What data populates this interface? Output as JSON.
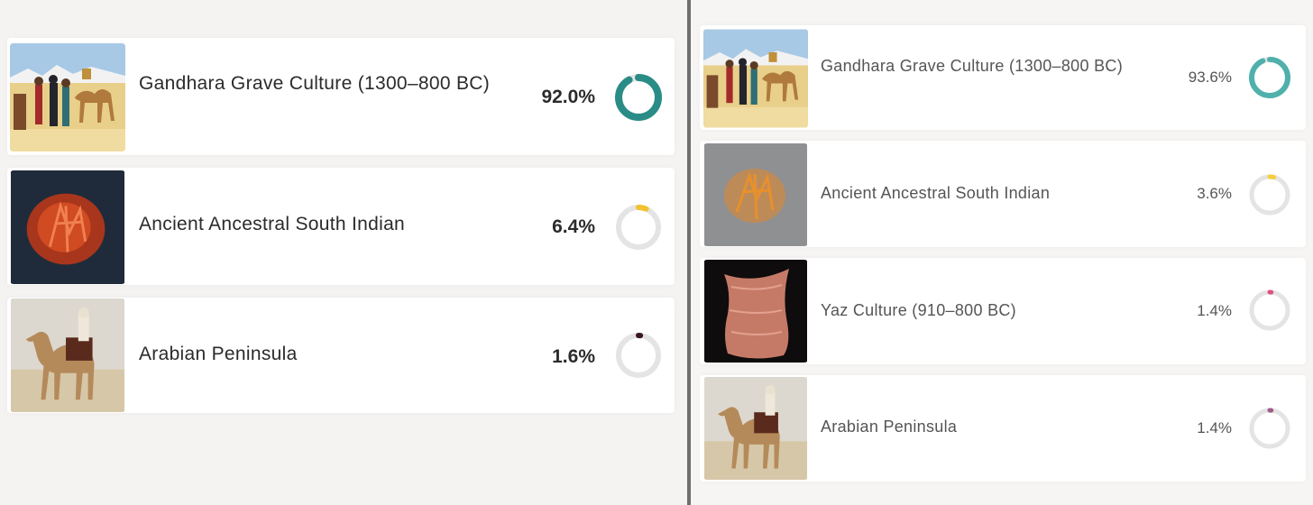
{
  "left": {
    "items": [
      {
        "label": "Gandhara Grave Culture (1300–800 BC)",
        "percent": "92.0%",
        "fraction": 0.92,
        "color": "#2a8c86"
      },
      {
        "label": "Ancient Ancestral South Indian",
        "percent": "6.4%",
        "fraction": 0.064,
        "color": "#f2c230"
      },
      {
        "label": "Arabian Peninsula",
        "percent": "1.6%",
        "fraction": 0.016,
        "color": "#3a1428"
      }
    ]
  },
  "right": {
    "items": [
      {
        "label": "Gandhara Grave Culture (1300–800 BC)",
        "percent": "93.6%",
        "fraction": 0.936,
        "color": "#4fb0ac"
      },
      {
        "label": "Ancient Ancestral South Indian",
        "percent": "3.6%",
        "fraction": 0.036,
        "color": "#f5cf3a"
      },
      {
        "label": "Yaz Culture (910–800 BC)",
        "percent": "1.4%",
        "fraction": 0.014,
        "color": "#e0507e"
      },
      {
        "label": "Arabian Peninsula",
        "percent": "1.4%",
        "fraction": 0.014,
        "color": "#a05a8a"
      }
    ]
  }
}
